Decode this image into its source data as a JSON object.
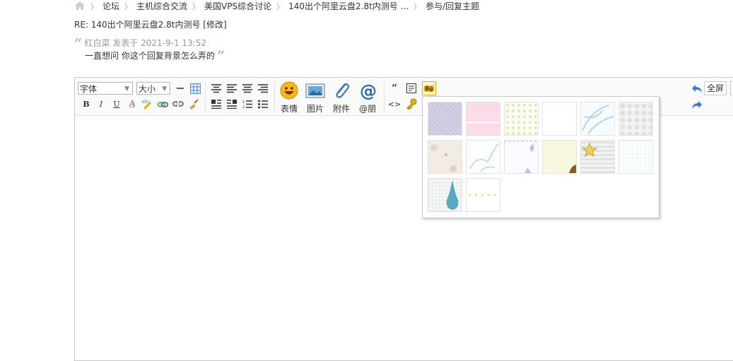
{
  "breadcrumb": {
    "items": [
      "论坛",
      "主机综合交流",
      "美国VPS综合讨论",
      "140出个阿里云盘2.8t内测号 ...",
      "参与/回复主题"
    ],
    "separator": "〉"
  },
  "reply": {
    "title": "RE: 140出个阿里云盘2.8t内测号 [修改]"
  },
  "quote": {
    "open_mark": "“",
    "close_mark": "”",
    "meta": "红白菜 发表于 2021-9-1 13:52",
    "text": "一直想问 你这个回复背景怎么弄的"
  },
  "toolbar": {
    "font_select": "字体",
    "size_select": "大小",
    "bold": "B",
    "italic": "I",
    "underline": "U",
    "font_color": "A",
    "emoji_label": "表情",
    "image_label": "图片",
    "attach_label": "附件",
    "mention_label": "@朋",
    "quote_icon": "“",
    "code_icon": "<>",
    "bg_icon": "Bg",
    "fullscreen_label": "全屏"
  },
  "colors": {
    "accent": "#336699",
    "toolbar_bg": "#fafafa",
    "border": "#c8c8c8",
    "highlight": "#ffcc33"
  },
  "bg_popup": {
    "swatches": [
      "lavender-weave",
      "pink-lace",
      "cream-dots",
      "plain-white",
      "blue-floral",
      "grey-lace",
      "beige-floral",
      "blue-ink-floral",
      "butterfly-border",
      "yellow-frame",
      "striped-star",
      "cyan-grid",
      "water-drop",
      "dotted-frame"
    ]
  }
}
